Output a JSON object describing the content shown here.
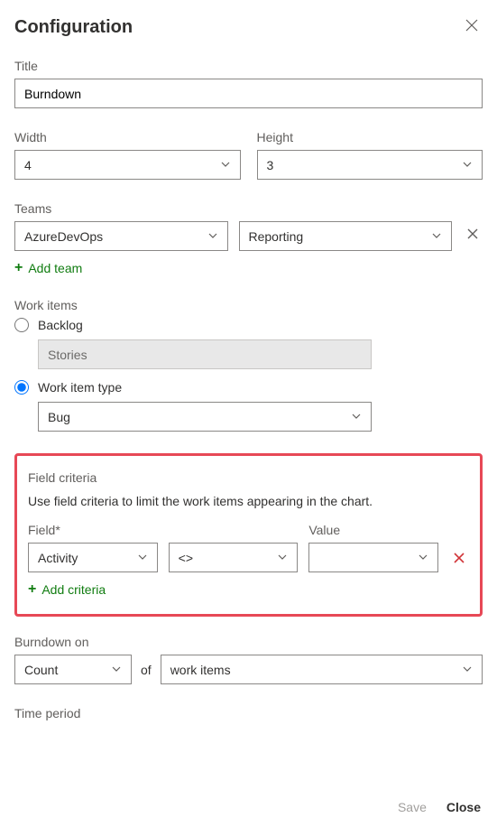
{
  "header": {
    "title": "Configuration"
  },
  "title_section": {
    "label": "Title",
    "value": "Burndown"
  },
  "dimensions": {
    "width_label": "Width",
    "width_value": "4",
    "height_label": "Height",
    "height_value": "3"
  },
  "teams": {
    "label": "Teams",
    "team1": "AzureDevOps",
    "team2": "Reporting",
    "add_label": "Add team"
  },
  "work_items": {
    "label": "Work items",
    "backlog_label": "Backlog",
    "backlog_value": "Stories",
    "type_label": "Work item type",
    "type_value": "Bug"
  },
  "field_criteria": {
    "title": "Field criteria",
    "helper": "Use field criteria to limit the work items appearing in the chart.",
    "field_label": "Field*",
    "field_value": "Activity",
    "operator_value": "<>",
    "value_label": "Value",
    "value_value": "",
    "add_label": "Add criteria"
  },
  "burndown_on": {
    "label": "Burndown on",
    "measure": "Count",
    "of_text": "of",
    "unit": "work items"
  },
  "time_period": {
    "label": "Time period"
  },
  "footer": {
    "save": "Save",
    "close": "Close"
  }
}
